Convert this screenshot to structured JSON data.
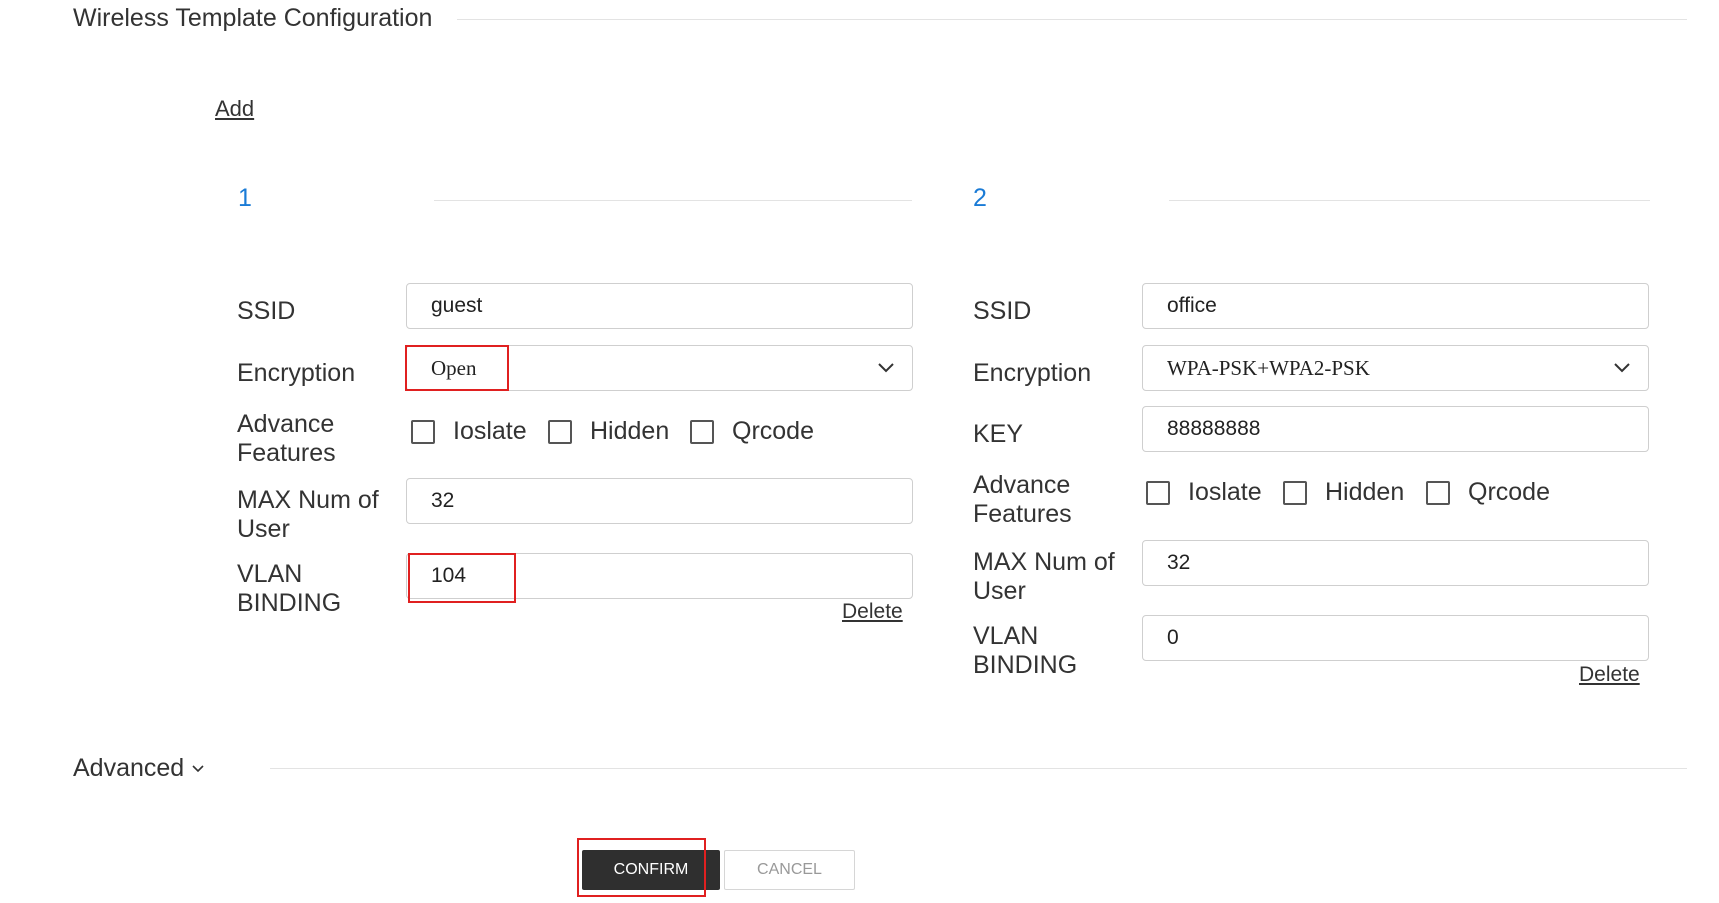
{
  "header": {
    "title": "Wireless Template Configuration"
  },
  "add_label": "Add",
  "groups": [
    {
      "number": "1",
      "ssid_label": "SSID",
      "ssid_value": "guest",
      "encryption_label": "Encryption",
      "encryption_value": "Open",
      "advance_label": [
        "Advance",
        "Features"
      ],
      "features": [
        "Ioslate",
        "Hidden",
        "Qrcode"
      ],
      "max_user_label": [
        "MAX Num of",
        "User"
      ],
      "max_user_value": "32",
      "vlan_label": [
        "VLAN",
        "BINDING"
      ],
      "vlan_value": "104",
      "delete_label": "Delete"
    },
    {
      "number": "2",
      "ssid_label": "SSID",
      "ssid_value": "office",
      "encryption_label": "Encryption",
      "encryption_value": "WPA-PSK+WPA2-PSK",
      "key_label": "KEY",
      "key_value": "88888888",
      "advance_label": [
        "Advance",
        "Features"
      ],
      "features": [
        "Ioslate",
        "Hidden",
        "Qrcode"
      ],
      "max_user_label": [
        "MAX Num of",
        "User"
      ],
      "max_user_value": "32",
      "vlan_label": [
        "VLAN",
        "BINDING"
      ],
      "vlan_value": "0",
      "delete_label": "Delete"
    }
  ],
  "advanced": {
    "label": "Advanced",
    "icon": "chevron-down-icon"
  },
  "buttons": {
    "confirm": "CONFIRM",
    "cancel": "CANCEL"
  },
  "colors": {
    "accent": "#1a7bd6",
    "highlight": "#e02020",
    "confirm_bg": "#2f2f2f"
  }
}
